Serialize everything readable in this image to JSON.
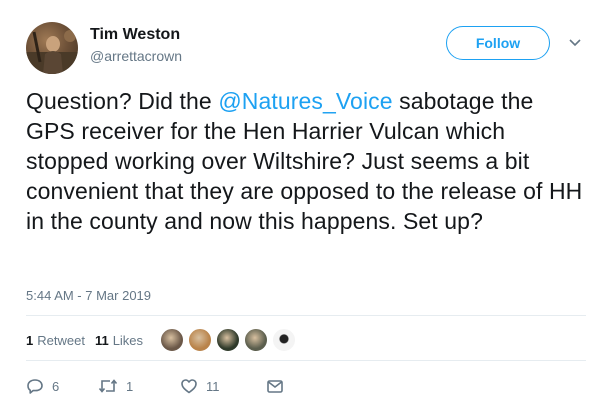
{
  "user": {
    "name": "Tim Weston",
    "handle": "@arrettacrown"
  },
  "follow_label": "Follow",
  "tweet": {
    "text_before": "Question? Did the ",
    "mention": "@Natures_Voice",
    "text_after": " sabotage the GPS receiver for the Hen Harrier Vulcan which stopped working over Wiltshire? Just seems a bit convenient that they are opposed to the release of HH in the county and now this happens. Set up?"
  },
  "timestamp": "5:44 AM - 7 Mar 2019",
  "stats": {
    "retweets_count": "1",
    "retweets_label": "Retweet",
    "likes_count": "11",
    "likes_label": "Likes"
  },
  "likers": [
    {
      "icon": "avatar-1",
      "color": "#6b5848"
    },
    {
      "icon": "avatar-2",
      "color": "#b9834a"
    },
    {
      "icon": "avatar-3",
      "color": "#2f3a2a"
    },
    {
      "icon": "avatar-4",
      "color": "#5b5e4d"
    },
    {
      "icon": "avatar-5",
      "color": "#f4f4f4"
    }
  ],
  "actions": {
    "reply_count": "6",
    "retweet_count": "1",
    "like_count": "11"
  },
  "colors": {
    "accent": "#1da1f2",
    "text": "#14171a",
    "muted": "#657786",
    "divider": "#e6ecf0"
  }
}
